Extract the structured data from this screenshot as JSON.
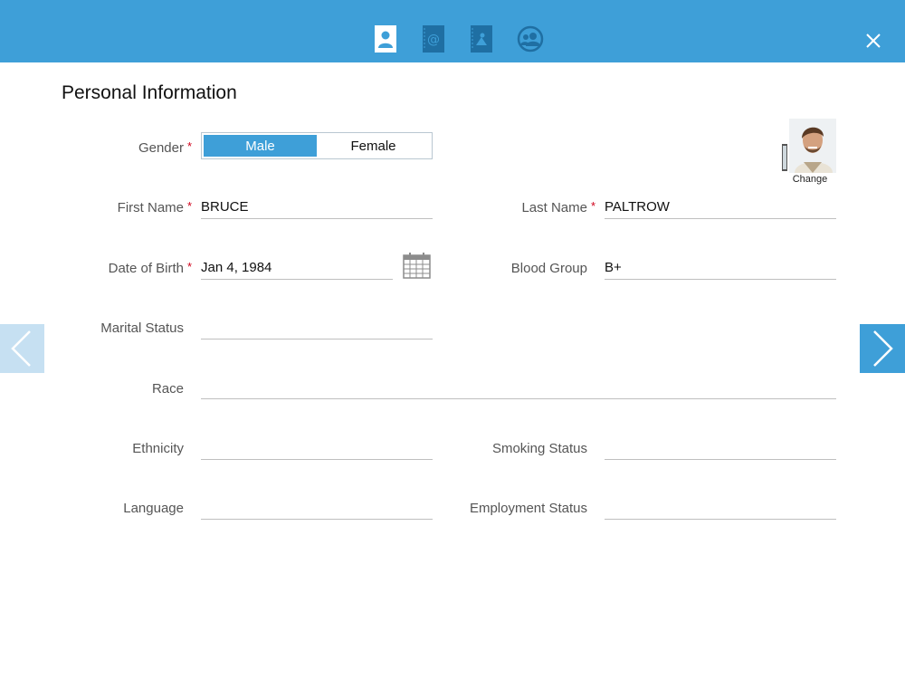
{
  "header": {
    "tabs": [
      {
        "name": "personal-info-tab",
        "icon": "contact-card-icon",
        "active": true
      },
      {
        "name": "contact-tab",
        "icon": "email-book-icon",
        "active": false
      },
      {
        "name": "address-tab",
        "icon": "address-book-icon",
        "active": false
      },
      {
        "name": "family-tab",
        "icon": "group-icon",
        "active": false
      }
    ],
    "close_icon": "close-icon"
  },
  "section": {
    "title": "Personal Information"
  },
  "form": {
    "gender": {
      "label": "Gender",
      "required": "*",
      "options": [
        "Male",
        "Female"
      ],
      "selected": "Male"
    },
    "first_name": {
      "label": "First Name",
      "required": "*",
      "value": "BRUCE"
    },
    "last_name": {
      "label": "Last Name",
      "required": "*",
      "value": "PALTROW"
    },
    "dob": {
      "label": "Date of Birth",
      "required": "*",
      "value": "Jan 4, 1984"
    },
    "blood_group": {
      "label": "Blood Group",
      "value": "B+"
    },
    "marital_status": {
      "label": "Marital Status",
      "value": ""
    },
    "race": {
      "label": "Race",
      "value": ""
    },
    "ethnicity": {
      "label": "Ethnicity",
      "value": ""
    },
    "smoking_status": {
      "label": "Smoking Status",
      "value": ""
    },
    "language": {
      "label": "Language",
      "value": ""
    },
    "employment_status": {
      "label": "Employment Status",
      "value": ""
    }
  },
  "photo": {
    "change_label": "Change"
  },
  "colors": {
    "accent": "#3e9fd8",
    "required": "#d0021b",
    "nav_inactive": "#c6e0f2"
  }
}
